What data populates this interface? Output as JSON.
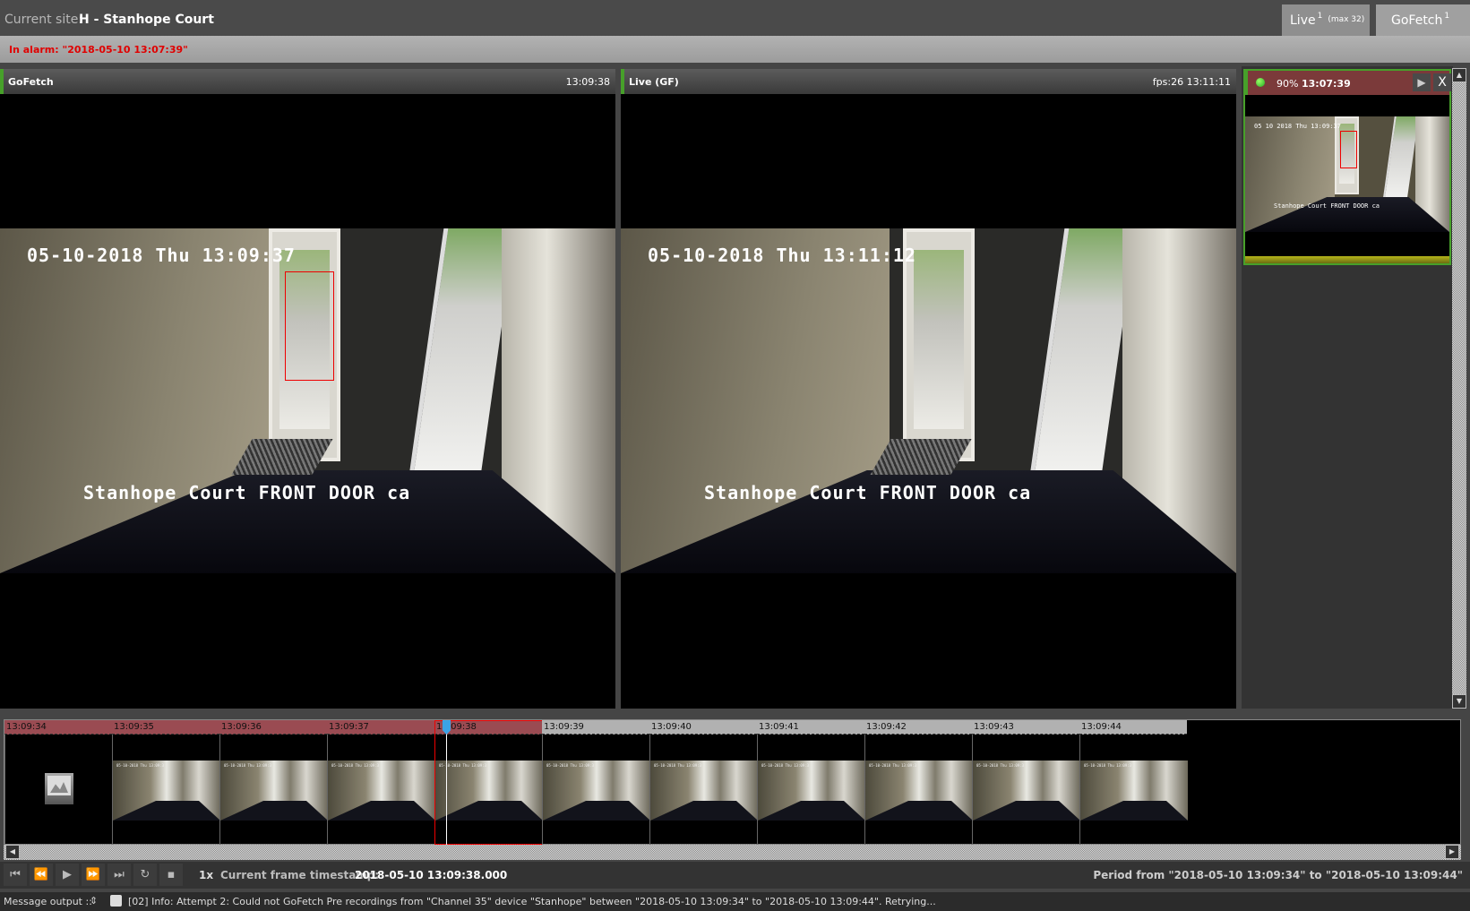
{
  "header": {
    "site_label": "Current site:",
    "site_name": "H - Stanhope Court",
    "tabs": [
      {
        "label": "Live",
        "count": "1",
        "note": "(max 32)"
      },
      {
        "label": "GoFetch",
        "count": "1"
      }
    ]
  },
  "alarm_bar": {
    "text": "In alarm: \"2018-05-10 13:07:39\""
  },
  "panes": [
    {
      "title": "GoFetch",
      "time": "13:09:38",
      "osd_top": "05-10-2018 Thu 13:09:37",
      "osd_bottom": "Stanhope Court FRONT DOOR ca",
      "has_detection_box": true
    },
    {
      "title": "Live (GF)",
      "time": "fps:26 13:11:11",
      "osd_top": "05-10-2018 Thu 13:11:12",
      "osd_bottom": "Stanhope Court FRONT DOOR ca",
      "has_detection_box": false
    }
  ],
  "alarm_list": {
    "items": [
      {
        "status": "online",
        "percent": "90%",
        "time": "13:07:39",
        "thumb_osd_top": "05 10 2018 Thu 13:09:37",
        "thumb_osd_bottom": "Stanhope Court FRONT DOOR ca",
        "progress": 1.0,
        "play_icon": "▶",
        "close_label": "X"
      }
    ]
  },
  "timeline": {
    "ticks": [
      {
        "label": "13:09:34",
        "alarm": true,
        "frame": "placeholder"
      },
      {
        "label": "13:09:35",
        "alarm": true,
        "frame": "image"
      },
      {
        "label": "13:09:36",
        "alarm": true,
        "frame": "image"
      },
      {
        "label": "13:09:37",
        "alarm": true,
        "frame": "image"
      },
      {
        "label": "13:09:38",
        "alarm": true,
        "frame": "image",
        "selected": true
      },
      {
        "label": "13:09:39",
        "alarm": false,
        "frame": "image"
      },
      {
        "label": "13:09:40",
        "alarm": false,
        "frame": "image"
      },
      {
        "label": "13:09:41",
        "alarm": false,
        "frame": "image"
      },
      {
        "label": "13:09:42",
        "alarm": false,
        "frame": "image"
      },
      {
        "label": "13:09:43",
        "alarm": false,
        "frame": "image"
      },
      {
        "label": "13:09:44",
        "alarm": false,
        "frame": "image"
      }
    ],
    "frame_osd": "05-10-2018 Thu 13:09:3"
  },
  "controls": {
    "buttons": [
      {
        "name": "skip-start",
        "glyph": "⏮"
      },
      {
        "name": "rewind",
        "glyph": "⏪"
      },
      {
        "name": "play",
        "glyph": "▶"
      },
      {
        "name": "fast-forward",
        "glyph": "⏩"
      },
      {
        "name": "skip-end",
        "glyph": "⏭"
      },
      {
        "name": "reload",
        "glyph": "↻"
      },
      {
        "name": "save",
        "glyph": "▪"
      }
    ],
    "speed": "1x",
    "current_label": "Current frame timestamp:",
    "current_value": "2018-05-10 13:09:38.000",
    "period": "Period from \"2018-05-10 13:09:34\" to \"2018-05-10 13:09:44\""
  },
  "messages": {
    "label": "Message output ::",
    "spinner": "⇕",
    "text": "[02]  Info: Attempt 2: Could not GoFetch Pre recordings from \"Channel 35\" device \"Stanhope\" between \"2018-05-10 13:09:34\" to \"2018-05-10 13:09:44\". Retrying..."
  },
  "colors": {
    "accent_green": "#47a02a",
    "alarm_red": "#e00000",
    "alarm_header": "#7b3a3a",
    "timeline_alarm": "#9a4b52",
    "playhead": "#3ba3e6"
  }
}
